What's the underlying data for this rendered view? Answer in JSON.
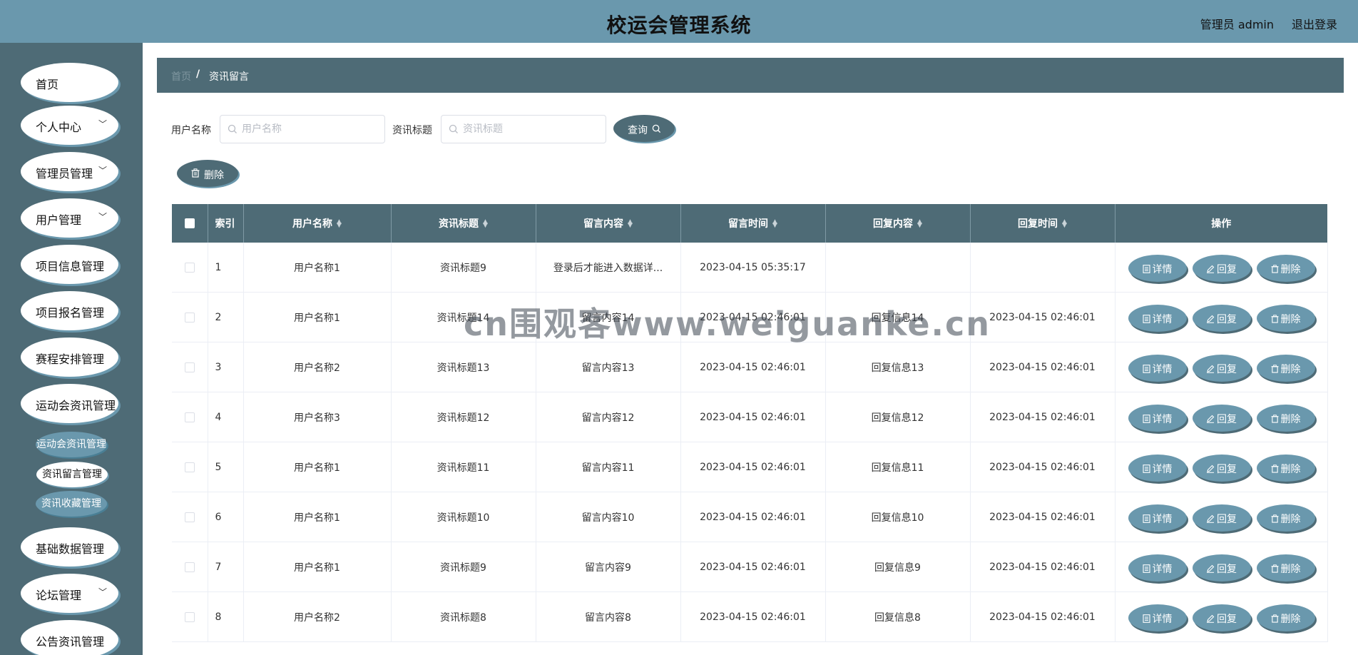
{
  "header": {
    "title": "校运会管理系统",
    "user": "管理员 admin",
    "logout": "退出登录"
  },
  "sidebar": {
    "items": [
      {
        "label": "首页",
        "has_children": false
      },
      {
        "label": "个人中心",
        "has_children": true
      },
      {
        "label": "管理员管理",
        "has_children": true
      },
      {
        "label": "用户管理",
        "has_children": true
      },
      {
        "label": "项目信息管理",
        "has_children": false
      },
      {
        "label": "项目报名管理",
        "has_children": false
      },
      {
        "label": "赛程安排管理",
        "has_children": false
      },
      {
        "label": "运动会资讯管理",
        "has_children": false
      },
      {
        "label": "基础数据管理",
        "has_children": false
      },
      {
        "label": "论坛管理",
        "has_children": true
      },
      {
        "label": "公告资讯管理",
        "has_children": false
      }
    ],
    "subitems": [
      "运动会资讯管理",
      "资讯留言管理",
      "资讯收藏管理"
    ]
  },
  "breadcrumb": {
    "home": "首页",
    "separator": "/",
    "current": "资讯留言"
  },
  "search": {
    "field1_label": "用户名称",
    "field1_placeholder": "用户名称",
    "field1_value": "",
    "field2_label": "资讯标题",
    "field2_placeholder": "资讯标题",
    "field2_value": "",
    "query_button": "查询"
  },
  "toolbar": {
    "delete_button": "删除"
  },
  "table": {
    "columns": [
      "索引",
      "用户名称",
      "资讯标题",
      "留言内容",
      "留言时间",
      "回复内容",
      "回复时间",
      "操作"
    ],
    "rows": [
      {
        "index": "1",
        "user": "用户名称1",
        "title": "资讯标题9",
        "content": "登录后才能进入数据详...",
        "time": "2023-04-15 05:35:17",
        "reply": "",
        "reply_time": ""
      },
      {
        "index": "2",
        "user": "用户名称1",
        "title": "资讯标题14",
        "content": "留言内容14",
        "time": "2023-04-15 02:46:01",
        "reply": "回复信息14",
        "reply_time": "2023-04-15 02:46:01"
      },
      {
        "index": "3",
        "user": "用户名称2",
        "title": "资讯标题13",
        "content": "留言内容13",
        "time": "2023-04-15 02:46:01",
        "reply": "回复信息13",
        "reply_time": "2023-04-15 02:46:01"
      },
      {
        "index": "4",
        "user": "用户名称3",
        "title": "资讯标题12",
        "content": "留言内容12",
        "time": "2023-04-15 02:46:01",
        "reply": "回复信息12",
        "reply_time": "2023-04-15 02:46:01"
      },
      {
        "index": "5",
        "user": "用户名称1",
        "title": "资讯标题11",
        "content": "留言内容11",
        "time": "2023-04-15 02:46:01",
        "reply": "回复信息11",
        "reply_time": "2023-04-15 02:46:01"
      },
      {
        "index": "6",
        "user": "用户名称1",
        "title": "资讯标题10",
        "content": "留言内容10",
        "time": "2023-04-15 02:46:01",
        "reply": "回复信息10",
        "reply_time": "2023-04-15 02:46:01"
      },
      {
        "index": "7",
        "user": "用户名称1",
        "title": "资讯标题9",
        "content": "留言内容9",
        "time": "2023-04-15 02:46:01",
        "reply": "回复信息9",
        "reply_time": "2023-04-15 02:46:01"
      },
      {
        "index": "8",
        "user": "用户名称2",
        "title": "资讯标题8",
        "content": "留言内容8",
        "time": "2023-04-15 02:46:01",
        "reply": "回复信息8",
        "reply_time": "2023-04-15 02:46:01"
      }
    ],
    "row_actions": {
      "detail": "详情",
      "reply": "回复",
      "delete": "删除"
    }
  },
  "watermark": "cn围观客www.weiguanke.cn",
  "colors": {
    "header": "#6a98ad",
    "sidebar": "#4e6b76",
    "accent": "#6a98ad",
    "dark": "#4e6b76"
  }
}
